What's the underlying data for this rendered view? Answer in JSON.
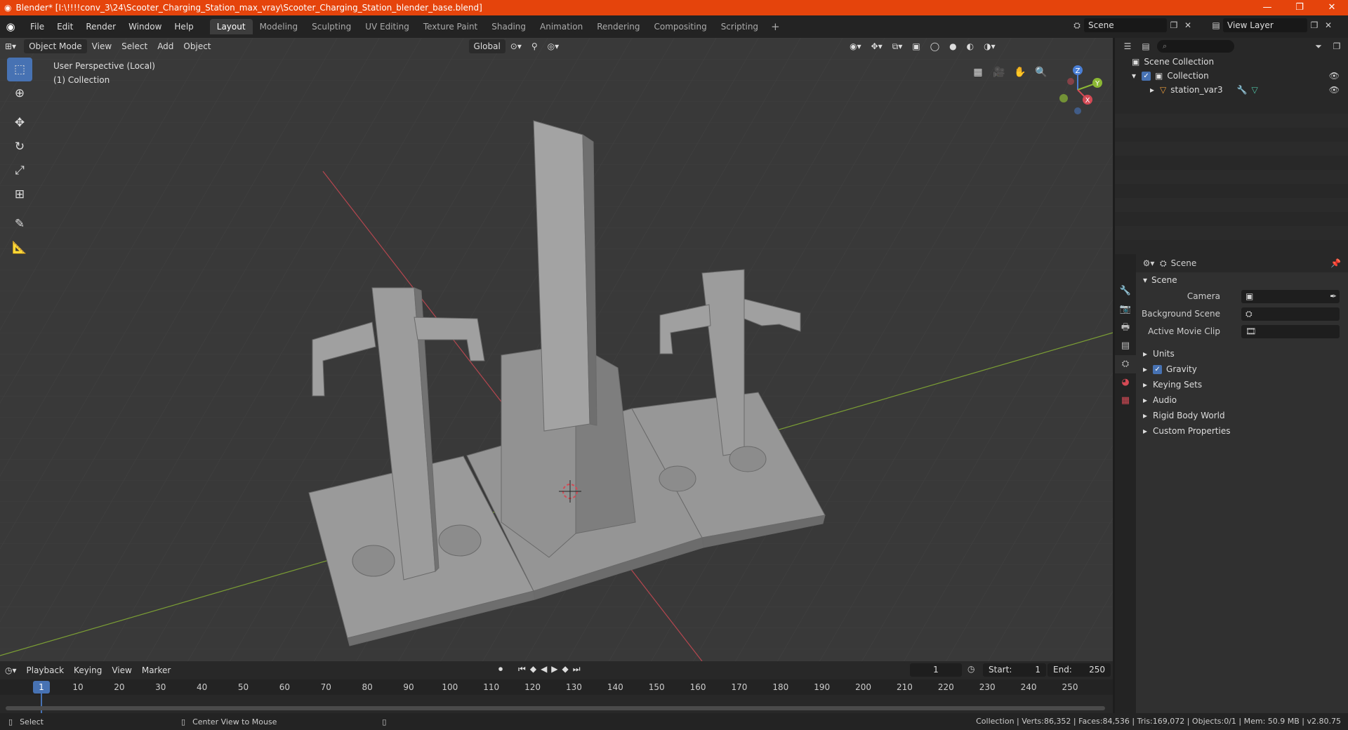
{
  "window": {
    "title": "Blender* [I:\\!!!!conv_3\\24\\Scooter_Charging_Station_max_vray\\Scooter_Charging_Station_blender_base.blend]",
    "minimize": "—",
    "maximize": "❐",
    "close": "✕"
  },
  "menu": [
    "File",
    "Edit",
    "Render",
    "Window",
    "Help"
  ],
  "workspaces": [
    "Layout",
    "Modeling",
    "Sculpting",
    "UV Editing",
    "Texture Paint",
    "Shading",
    "Animation",
    "Rendering",
    "Compositing",
    "Scripting"
  ],
  "active_workspace": "Layout",
  "scene_selector": {
    "value": "Scene"
  },
  "view_layer_selector": {
    "value": "View Layer"
  },
  "viewport_header": {
    "mode": "Object Mode",
    "menus": [
      "View",
      "Select",
      "Add",
      "Object"
    ],
    "orientation": "Global"
  },
  "viewport_info": {
    "line1": "User Perspective (Local)",
    "line2": "(1) Collection"
  },
  "gizmo_axes": [
    "Z",
    "Y",
    "X"
  ],
  "outliner": {
    "root": "Scene Collection",
    "collection": "Collection",
    "object": "station_var3"
  },
  "properties": {
    "header": "Scene",
    "section": "Scene",
    "fields": [
      {
        "label": "Camera"
      },
      {
        "label": "Background Scene"
      },
      {
        "label": "Active Movie Clip"
      }
    ],
    "panels": [
      "Units",
      "Gravity",
      "Keying Sets",
      "Audio",
      "Rigid Body World",
      "Custom Properties"
    ],
    "gravity_checked": true
  },
  "timeline": {
    "menus": [
      "Playback",
      "Keying",
      "View",
      "Marker"
    ],
    "current_frame": "1",
    "start_label": "Start:",
    "start": "1",
    "end_label": "End:",
    "end": "250",
    "ruler": [
      "1",
      "10",
      "20",
      "30",
      "40",
      "50",
      "60",
      "70",
      "80",
      "90",
      "100",
      "110",
      "120",
      "130",
      "140",
      "150",
      "160",
      "170",
      "180",
      "190",
      "200",
      "210",
      "220",
      "230",
      "240",
      "250"
    ]
  },
  "statusbar": {
    "left": "Select",
    "middle": "Center View to Mouse",
    "right": "Collection | Verts:86,352 | Faces:84,536 | Tris:169,072 | Objects:0/1 | Mem: 50.9 MB | v2.80.75"
  },
  "colors": {
    "titlebar": "#e5440c",
    "accent": "#4772b3",
    "viewport_bg": "#393939",
    "x_axis": "#d44a55",
    "y_axis": "#8cb834"
  }
}
